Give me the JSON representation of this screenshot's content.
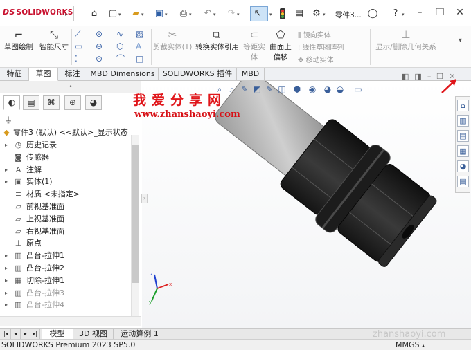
{
  "titlebar": {
    "logo_prefix": "DS",
    "logo_text": "SOLIDWORKS",
    "document_title": "零件3...",
    "icons": [
      "home-icon",
      "new-document-icon",
      "open-icon",
      "save-icon",
      "print-icon",
      "undo-icon",
      "redo-icon",
      "select-icon",
      "rebuild-icon",
      "file-properties-icon",
      "options-icon",
      "search-icon",
      "help-icon",
      "user-icon",
      "minimize-icon",
      "restore-icon",
      "close-icon"
    ]
  },
  "ribbon": {
    "sketch": "草图绘制",
    "smart_dimension": "智能尺寸",
    "trim_entities": "剪裁实体(T)",
    "convert_entities": "转换实体引用",
    "offset_entities_line1": "等距实",
    "offset_entities_line2": "体",
    "offset_on_surface_line1": "曲面上",
    "offset_on_surface_line2": "偏移",
    "mirror_entities": "镜向实体",
    "linear_sketch_pattern": "线性草图阵列",
    "move_entities": "移动实体",
    "display_delete_relations": "显示/删除几何关系"
  },
  "tabs": [
    {
      "label": "特征",
      "active": false
    },
    {
      "label": "草图",
      "active": true
    },
    {
      "label": "标注",
      "active": false
    },
    {
      "label": "MBD Dimensions",
      "active": false
    },
    {
      "label": "SOLIDWORKS 插件",
      "active": false
    },
    {
      "label": "MBD",
      "active": false
    }
  ],
  "tree": {
    "root": "零件3 (默认) <<默认>_显示状态",
    "items": [
      {
        "label": "历史记录",
        "icon": "history-icon",
        "expandable": true,
        "gray": false
      },
      {
        "label": "传感器",
        "icon": "sensor-icon",
        "expandable": false,
        "gray": false
      },
      {
        "label": "注解",
        "icon": "annotation-icon",
        "expandable": true,
        "gray": false
      },
      {
        "label": "实体(1)",
        "icon": "solid-bodies-icon",
        "expandable": true,
        "gray": false
      },
      {
        "label": "材质 <未指定>",
        "icon": "material-icon",
        "expandable": false,
        "gray": false
      },
      {
        "label": "前视基准面",
        "icon": "plane-icon",
        "expandable": false,
        "gray": false
      },
      {
        "label": "上视基准面",
        "icon": "plane-icon",
        "expandable": false,
        "gray": false
      },
      {
        "label": "右视基准面",
        "icon": "plane-icon",
        "expandable": false,
        "gray": false
      },
      {
        "label": "原点",
        "icon": "origin-icon",
        "expandable": false,
        "gray": false
      },
      {
        "label": "凸台-拉伸1",
        "icon": "extrude-boss-icon",
        "expandable": true,
        "gray": false
      },
      {
        "label": "凸台-拉伸2",
        "icon": "extrude-boss-icon",
        "expandable": true,
        "gray": false
      },
      {
        "label": "切除-拉伸1",
        "icon": "extrude-cut-icon",
        "expandable": true,
        "gray": false
      },
      {
        "label": "凸台-拉伸3",
        "icon": "extrude-boss-icon",
        "expandable": true,
        "gray": true
      },
      {
        "label": "凸台-拉伸4",
        "icon": "extrude-boss-icon",
        "expandable": true,
        "gray": true
      }
    ]
  },
  "watermark": {
    "title": "我爱分享网",
    "url": "www.zhanshaoyi.com",
    "url_corner": "zhanshaoyi.com"
  },
  "bottom_tabs": [
    {
      "label": "模型",
      "active": true
    },
    {
      "label": "3D 视图",
      "active": false
    },
    {
      "label": "运动算例 1",
      "active": false
    }
  ],
  "status": {
    "text": "SOLIDWORKS Premium 2023 SP5.0",
    "units": "MMGS"
  },
  "colors": {
    "brand_red": "#c8102e",
    "watermark_red": "#e0151a",
    "selection_blue": "#cde3f7",
    "part_dark": "#1e1e1e"
  }
}
